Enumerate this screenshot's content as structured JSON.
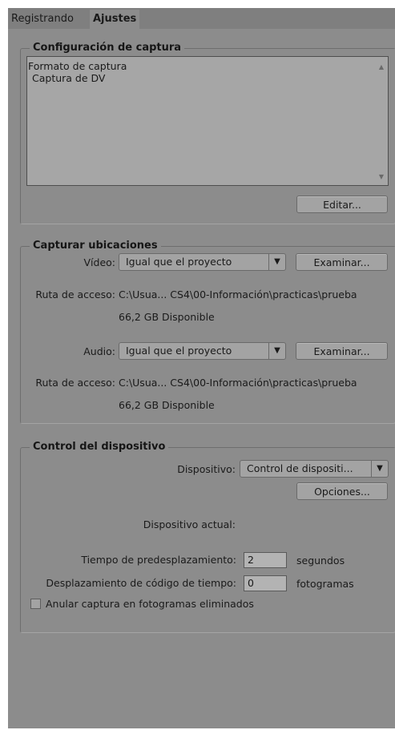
{
  "tabs": [
    {
      "label": "Registrando"
    },
    {
      "label": "Ajustes"
    }
  ],
  "capture_settings": {
    "title": "Configuración de captura",
    "list_items": [
      "Formato de captura",
      "Captura de DV"
    ],
    "edit_button": "Editar..."
  },
  "capture_locations": {
    "title": "Capturar ubicaciones",
    "video": {
      "label": "Vídeo:",
      "select_value": "Igual que el proyecto",
      "browse_button": "Examinar...",
      "path_label": "Ruta de acceso:",
      "path_value": "C:\\Usua... CS4\\00-Información\\practicas\\prueba",
      "available": "66,2 GB Disponible"
    },
    "audio": {
      "label": "Audio:",
      "select_value": "Igual que el proyecto",
      "browse_button": "Examinar...",
      "path_label": "Ruta de acceso:",
      "path_value": "C:\\Usua... CS4\\00-Información\\practicas\\prueba",
      "available": "66,2 GB Disponible"
    }
  },
  "device_control": {
    "title": "Control del dispositivo",
    "device_label": "Dispositivo:",
    "device_value": "Control de dispositi...",
    "options_button": "Opciones...",
    "current_device_label": "Dispositivo actual:",
    "preroll_label": "Tiempo de predesplazamiento:",
    "preroll_value": "2",
    "preroll_unit": "segundos",
    "timecode_offset_label": "Desplazamiento de código de tiempo:",
    "timecode_offset_value": "0",
    "timecode_offset_unit": "fotogramas",
    "abort_checkbox_label": "Anular captura en fotogramas eliminados",
    "abort_checked": false
  }
}
